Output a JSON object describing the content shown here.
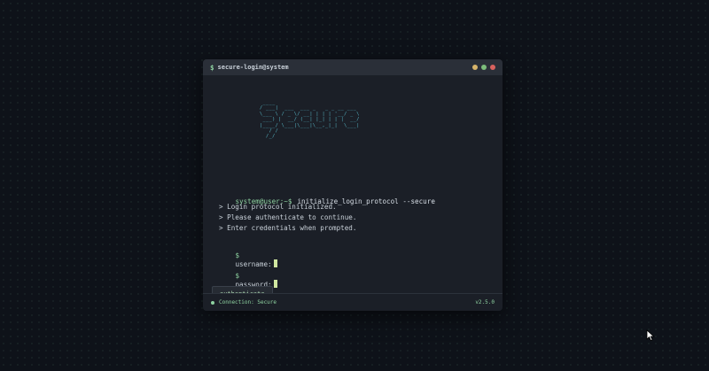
{
  "window": {
    "title_prompt": "$",
    "title": "secure-login@system",
    "dot_colors": [
      "#d7b46a",
      "#7cbd7b",
      "#d9625e"
    ]
  },
  "banner": {
    "ascii_art": " ____                          \n/ ___|  ___  ___ _   _ _ __ ___ \n\\___ \\ / _ \\/ __| | | | '__/ _ \\\n ___) |  __/ (__| |_| | | |  __/\n|____/ \\___|\\___|\\__,_|_|  \\___|\n   / /                          \n  /_/                           "
  },
  "command": {
    "prompt": "system@user:~$",
    "text": "initialize_login_protocol --secure"
  },
  "output": [
    "> Login protocol initialized.",
    "> Please authenticate to continue.",
    "> Enter credentials when prompted."
  ],
  "fields": {
    "username": {
      "prompt": "$",
      "label": "username:",
      "value": ""
    },
    "password": {
      "prompt": "$",
      "label": "password:",
      "value": ""
    }
  },
  "buttons": {
    "authenticate": "authenticate"
  },
  "status": {
    "connection": "Connection: Secure",
    "version": "v2.5.0",
    "dot_color": "#8fd3a1"
  },
  "colors": {
    "accent_green": "#8fd3a1",
    "ascii_cyan": "#58b9c9",
    "background": "#0e1219"
  }
}
